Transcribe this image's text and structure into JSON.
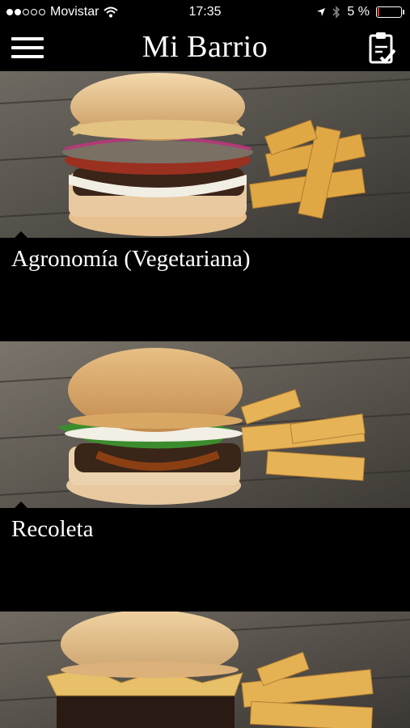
{
  "status": {
    "carrier": "Movistar",
    "time": "17:35",
    "battery": "5 %",
    "battery_level": 0.05,
    "signal_bars": 2
  },
  "header": {
    "title": "Mi Barrio",
    "menu_icon": "hamburger-menu-icon",
    "right_icon": "clipboard-check-icon"
  },
  "cards": [
    {
      "title": "Agronomía (Vegetariana)"
    },
    {
      "title": "Recoleta"
    },
    {
      "title": ""
    }
  ]
}
